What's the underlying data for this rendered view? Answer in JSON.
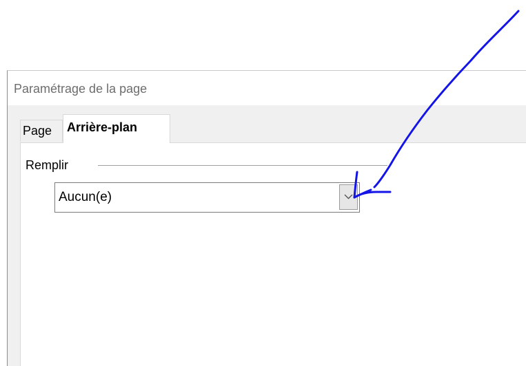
{
  "window": {
    "title": "Paramétrage de la page"
  },
  "tabs": [
    {
      "label": "Page",
      "active": false
    },
    {
      "label": "Arrière-plan",
      "active": true
    }
  ],
  "fill": {
    "group_label": "Remplir",
    "selected": "Aucun(e)"
  },
  "icons": {
    "dropdown": "chevron-down-icon"
  },
  "colors": {
    "annotation_ink": "#1414e6"
  }
}
